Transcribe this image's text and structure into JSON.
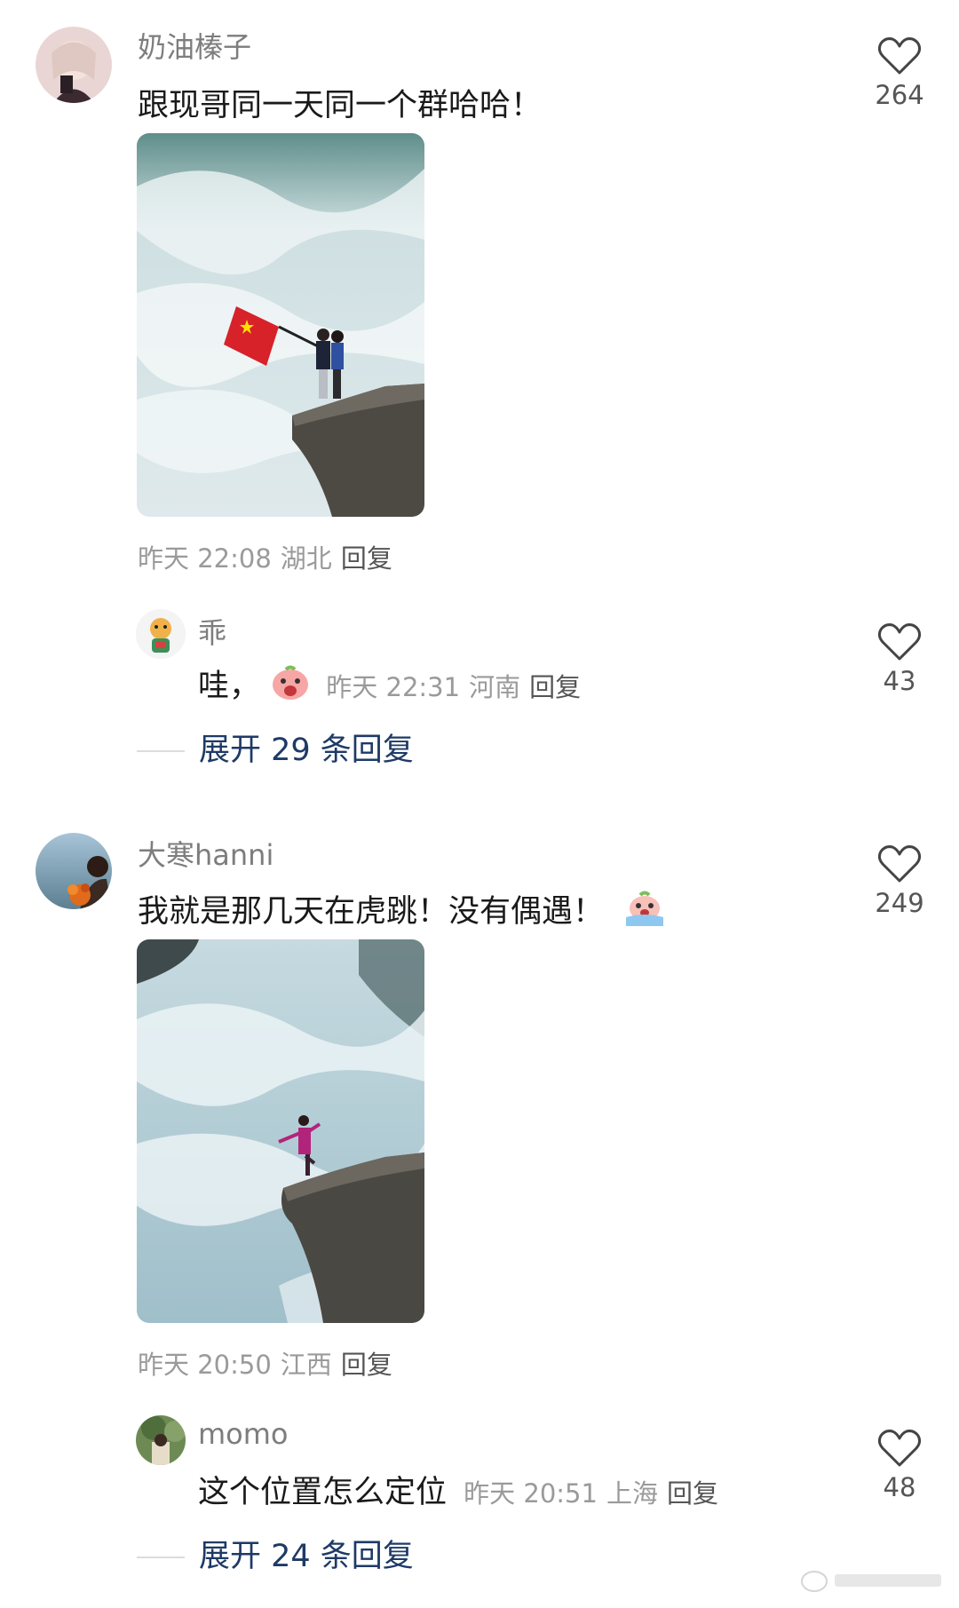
{
  "comments": [
    {
      "username": "奶油榛子",
      "text": "跟现哥同一天同一个群哈哈！",
      "meta": {
        "time": "昨天 22:08",
        "location": "湖北",
        "reply": "回复"
      },
      "likes": "264",
      "reply": {
        "username": "乖",
        "text": "哇，",
        "meta": {
          "time": "昨天 22:31",
          "location": "河南",
          "reply": "回复"
        },
        "likes": "43"
      },
      "expand_label": "展开 29 条回复"
    },
    {
      "username": "大寒hanni",
      "text": "我就是那几天在虎跳！没有偶遇！",
      "meta": {
        "time": "昨天 20:50",
        "location": "江西",
        "reply": "回复"
      },
      "likes": "249",
      "reply": {
        "username": "momo",
        "text": "这个位置怎么定位",
        "meta": {
          "time": "昨天 20:51",
          "location": "上海",
          "reply": "回复"
        },
        "likes": "48"
      },
      "expand_label": "展开 24 条回复"
    }
  ],
  "icons": {
    "like": "heart-outline-icon"
  },
  "colors": {
    "expand_link": "#1e3a66",
    "meta": "#9a9a9a",
    "username": "#7d7d7d"
  }
}
